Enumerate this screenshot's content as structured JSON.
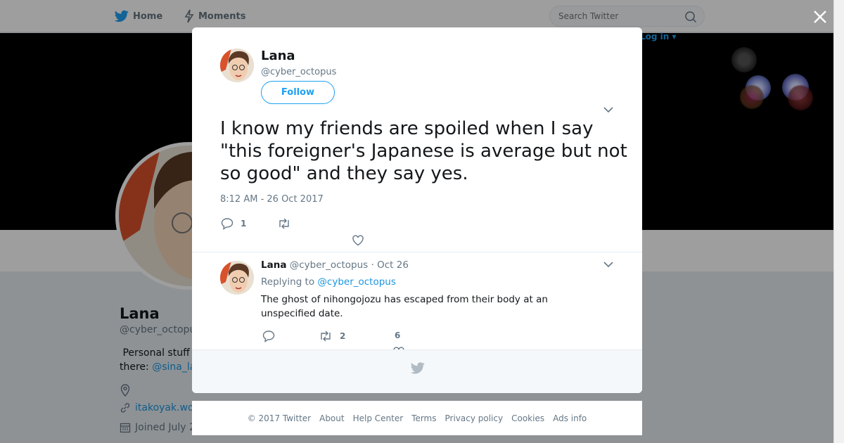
{
  "nav": {
    "home_label": "Home",
    "moments_label": "Moments",
    "search_placeholder": "Search Twitter",
    "login_label": "Log in"
  },
  "profile": {
    "name": "Lana",
    "handle": "@cyber_octopus",
    "bio_prefix": "Personal stuff",
    "bio_line2": "there:",
    "bio_link": "@sina_la",
    "website": "itakoyak.wo",
    "joined": "Joined July 2"
  },
  "tweet": {
    "author_name": "Lana",
    "author_handle": "@cyber_octopus",
    "follow_label": "Follow",
    "text": "I know my friends are spoiled when I say \"this foreigner's Japanese is average but not so good\" and they say yes.",
    "timestamp": "8:12 AM - 26 Oct 2017",
    "reply_count": "1",
    "retweet_count": "",
    "like_count": ""
  },
  "reply": {
    "author_name": "Lana",
    "author_handle": "@cyber_octopus",
    "date_meta": "· Oct 26",
    "replying_prefix": "Replying to",
    "replying_to": "@cyber_octopus",
    "text": "The ghost of nihongojozu has escaped from their body at an unspecified date.",
    "reply_count": "",
    "retweet_count": "2",
    "like_count": "6"
  },
  "footer": {
    "copyright": "© 2017 Twitter",
    "links": [
      "About",
      "Help Center",
      "Terms",
      "Privacy policy",
      "Cookies",
      "Ads info"
    ]
  },
  "colors": {
    "brand": "#1da1f2",
    "link": "#1b95e0",
    "text_secondary": "#657786"
  },
  "icons": [
    "twitter-bird-icon",
    "lightning-icon",
    "search-icon",
    "close-icon",
    "chevron-down-icon",
    "reply-icon",
    "retweet-icon",
    "heart-icon",
    "location-icon",
    "link-icon",
    "calendar-icon"
  ]
}
